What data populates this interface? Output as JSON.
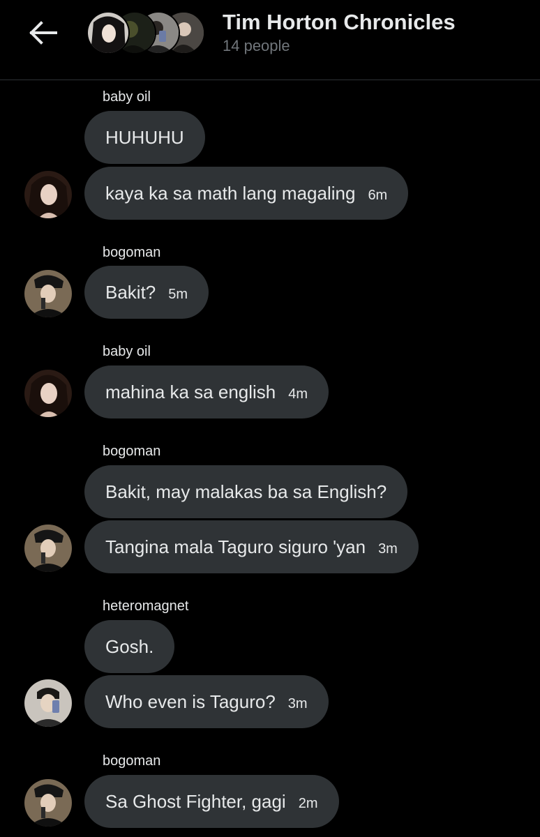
{
  "header": {
    "title": "Tim Horton Chronicles",
    "subtitle": "14 people",
    "back_icon": "back-arrow-icon"
  },
  "messages": [
    {
      "sender": "baby oil",
      "bubbles": [
        {
          "text": "HUHUHU",
          "time": ""
        },
        {
          "text": "kaya ka sa math lang magaling",
          "time": "6m"
        }
      ],
      "avatar": "avatar-baby-oil"
    },
    {
      "sender": "bogoman",
      "bubbles": [
        {
          "text": "Bakit?",
          "time": "5m"
        }
      ],
      "avatar": "avatar-bogoman"
    },
    {
      "sender": "baby oil",
      "bubbles": [
        {
          "text": "mahina ka sa english",
          "time": "4m"
        }
      ],
      "avatar": "avatar-baby-oil"
    },
    {
      "sender": "bogoman",
      "bubbles": [
        {
          "text": "Bakit, may malakas ba sa English?",
          "time": ""
        },
        {
          "text": "Tangina mala Taguro siguro 'yan",
          "time": "3m"
        }
      ],
      "avatar": "avatar-bogoman"
    },
    {
      "sender": "heteromagnet",
      "bubbles": [
        {
          "text": "Gosh.",
          "time": ""
        },
        {
          "text": "Who even is Taguro?",
          "time": "3m"
        }
      ],
      "avatar": "avatar-heteromagnet"
    },
    {
      "sender": "bogoman",
      "bubbles": [
        {
          "text": "Sa Ghost Fighter, gagi",
          "time": "2m"
        }
      ],
      "avatar": "avatar-bogoman"
    }
  ],
  "colors": {
    "background": "#000000",
    "bubble": "#2f3336",
    "text": "#e7e9ea",
    "muted": "#71767b",
    "divider": "#2f3336"
  }
}
